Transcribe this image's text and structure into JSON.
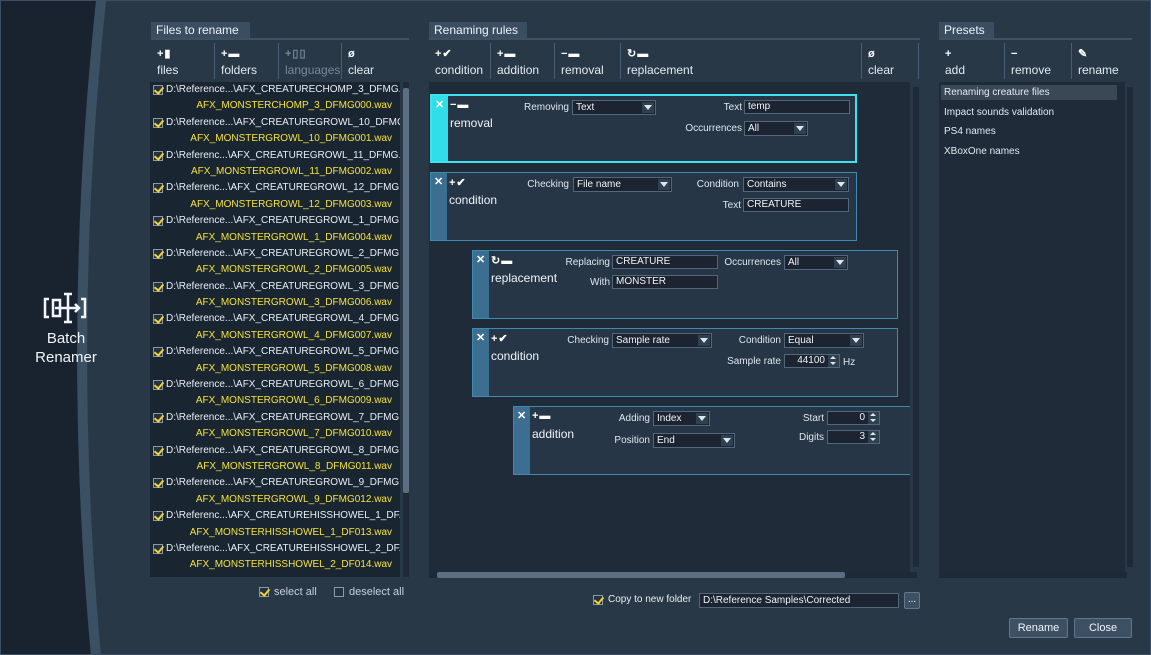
{
  "brand": {
    "name_line1": "Batch",
    "name_line2": "Renamer",
    "icon": "batch-renamer-logo-icon"
  },
  "files_panel": {
    "title": "Files to rename",
    "toolbar": [
      {
        "icon": "add-files-icon",
        "glyph": "+▮",
        "label": "files",
        "enabled": true
      },
      {
        "icon": "add-folders-icon",
        "glyph": "+▬",
        "label": "folders",
        "enabled": true
      },
      {
        "icon": "add-languages-icon",
        "glyph": "+▯▯",
        "label": "languages",
        "enabled": false
      },
      {
        "icon": "clear-icon",
        "glyph": "ø",
        "label": "clear",
        "enabled": true
      }
    ],
    "files": [
      {
        "path": "D:\\Reference...\\AFX_CREATURECHOMP_3_DFMG.wav",
        "new_name": "AFX_MONSTERCHOMP_3_DFMG000.wav"
      },
      {
        "path": "D:\\Reference...\\AFX_CREATUREGROWL_10_DFMG.wav",
        "new_name": "AFX_MONSTERGROWL_10_DFMG001.wav"
      },
      {
        "path": "D:\\Referenc...\\AFX_CREATUREGROWL_11_DFMG.wav",
        "new_name": "AFX_MONSTERGROWL_11_DFMG002.wav"
      },
      {
        "path": "D:\\Referenc...\\AFX_CREATUREGROWL_12_DFMG.wav",
        "new_name": "AFX_MONSTERGROWL_12_DFMG003.wav"
      },
      {
        "path": "D:\\Reference...\\AFX_CREATUREGROWL_1_DFMG.wav",
        "new_name": "AFX_MONSTERGROWL_1_DFMG004.wav"
      },
      {
        "path": "D:\\Reference...\\AFX_CREATUREGROWL_2_DFMG.wav",
        "new_name": "AFX_MONSTERGROWL_2_DFMG005.wav"
      },
      {
        "path": "D:\\Reference...\\AFX_CREATUREGROWL_3_DFMG.wav",
        "new_name": "AFX_MONSTERGROWL_3_DFMG006.wav"
      },
      {
        "path": "D:\\Reference...\\AFX_CREATUREGROWL_4_DFMG.wav",
        "new_name": "AFX_MONSTERGROWL_4_DFMG007.wav"
      },
      {
        "path": "D:\\Reference...\\AFX_CREATUREGROWL_5_DFMG.wav",
        "new_name": "AFX_MONSTERGROWL_5_DFMG008.wav"
      },
      {
        "path": "D:\\Reference...\\AFX_CREATUREGROWL_6_DFMG.wav",
        "new_name": "AFX_MONSTERGROWL_6_DFMG009.wav"
      },
      {
        "path": "D:\\Reference...\\AFX_CREATUREGROWL_7_DFMG.wav",
        "new_name": "AFX_MONSTERGROWL_7_DFMG010.wav"
      },
      {
        "path": "D:\\Reference...\\AFX_CREATUREGROWL_8_DFMG.wav",
        "new_name": "AFX_MONSTERGROWL_8_DFMG011.wav"
      },
      {
        "path": "D:\\Reference...\\AFX_CREATUREGROWL_9_DFMG.wav",
        "new_name": "AFX_MONSTERGROWL_9_DFMG012.wav"
      },
      {
        "path": "D:\\Referenc...\\AFX_CREATUREHISSHOWEL_1_DF.wav",
        "new_name": "AFX_MONSTERHISSHOWEL_1_DF013.wav"
      },
      {
        "path": "D:\\Referenc...\\AFX_CREATUREHISSHOWEL_2_DF.wav",
        "new_name": "AFX_MONSTERHISSHOWEL_2_DF014.wav"
      }
    ],
    "select_all": {
      "label": "select all",
      "checked": true
    },
    "deselect_all": {
      "label": "deselect all",
      "checked": false
    }
  },
  "rules_panel": {
    "title": "Renaming rules",
    "toolbar": [
      {
        "icon": "add-condition-icon",
        "glyph": "+✔",
        "label": "condition"
      },
      {
        "icon": "add-addition-icon",
        "glyph": "+▬",
        "label": "addition"
      },
      {
        "icon": "add-removal-icon",
        "glyph": "−▬",
        "label": "removal"
      },
      {
        "icon": "add-replacement-icon",
        "glyph": "↻▬",
        "label": "replacement"
      }
    ],
    "clear": {
      "icon": "clear-icon",
      "glyph": "ø",
      "label": "clear"
    },
    "rules": {
      "removal": {
        "glyph": "−▬",
        "name": "removal",
        "removing_label": "Removing",
        "removing_value": "Text",
        "text_label": "Text",
        "text_value": "temp",
        "occurrences_label": "Occurrences",
        "occurrences_value": "All"
      },
      "condition1": {
        "glyph": "+✔",
        "name": "condition",
        "checking_label": "Checking",
        "checking_value": "File name",
        "condition_label": "Condition",
        "condition_value": "Contains",
        "text_label": "Text",
        "text_value": "CREATURE"
      },
      "replacement": {
        "glyph": "↻▬",
        "name": "replacement",
        "replacing_label": "Replacing",
        "replacing_value": "CREATURE",
        "with_label": "With",
        "with_value": "MONSTER",
        "occurrences_label": "Occurrences",
        "occurrences_value": "All"
      },
      "condition2": {
        "glyph": "+✔",
        "name": "condition",
        "checking_label": "Checking",
        "checking_value": "Sample rate",
        "condition_label": "Condition",
        "condition_value": "Equal",
        "rate_label": "Sample rate",
        "rate_value": "44100",
        "rate_unit": "Hz"
      },
      "addition": {
        "glyph": "+▬",
        "name": "addition",
        "adding_label": "Adding",
        "adding_value": "Index",
        "position_label": "Position",
        "position_value": "End",
        "start_label": "Start",
        "start_value": "0",
        "digits_label": "Digits",
        "digits_value": "3"
      }
    },
    "copy_to_folder": {
      "label": "Copy to new folder",
      "checked": true,
      "path": "D:\\Reference Samples\\Corrected",
      "browse": "..."
    }
  },
  "presets_panel": {
    "title": "Presets",
    "toolbar": [
      {
        "icon": "add-preset-icon",
        "glyph": "+",
        "label": "add"
      },
      {
        "icon": "remove-preset-icon",
        "glyph": "−",
        "label": "remove"
      },
      {
        "icon": "rename-preset-icon",
        "glyph": "✎",
        "label": "rename"
      }
    ],
    "items": [
      "Renaming creature files",
      "Impact sounds validation",
      "PS4 names",
      "XBoxOne names"
    ],
    "selected_index": 0
  },
  "actions": {
    "rename": "Rename",
    "close": "Close"
  },
  "colors": {
    "accent_active": "#3fe1ee",
    "rule_border": "#3e8ab1",
    "new_name": "#f4e23a",
    "check": "#f3d431"
  }
}
